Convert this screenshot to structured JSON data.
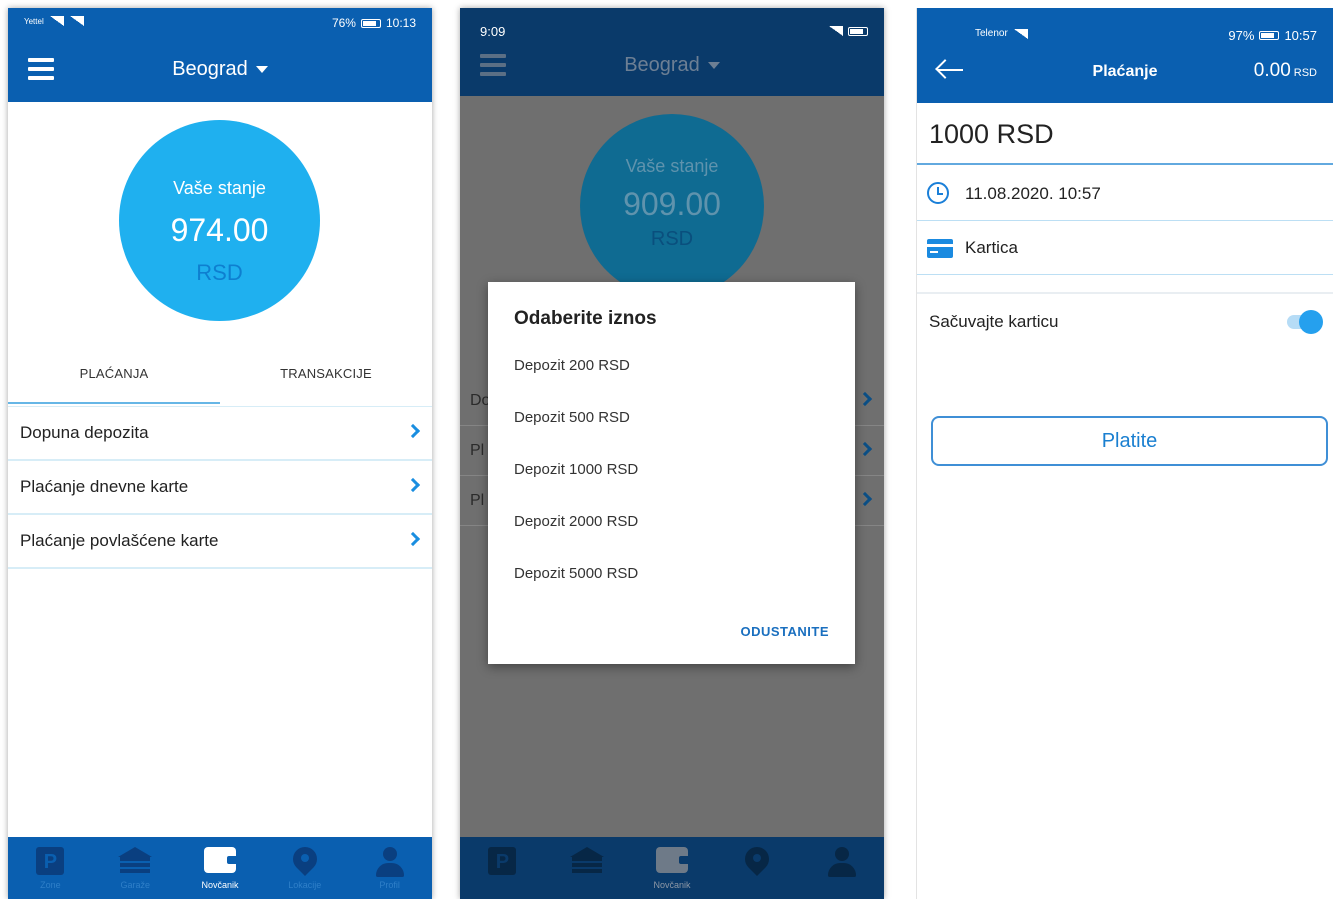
{
  "colors": {
    "primary": "#0a5fb0",
    "accent": "#1fb0ef",
    "link": "#1a8ee0"
  },
  "screen1": {
    "status": {
      "left": "Yettel",
      "battery": "76%",
      "time": "10:13"
    },
    "city": "Beograd",
    "balance": {
      "label": "Vaše stanje",
      "amount": "974.00",
      "currency": "RSD"
    },
    "tabs": [
      {
        "label": "PLAĆANJA"
      },
      {
        "label": "TRANSAKCIJE"
      }
    ],
    "items": [
      {
        "label": "Dopuna depozita"
      },
      {
        "label": "Plaćanje dnevne karte"
      },
      {
        "label": "Plaćanje povlašćene karte"
      }
    ],
    "nav": [
      {
        "label": "Zone",
        "icon": "parking-icon"
      },
      {
        "label": "Garaže",
        "icon": "garage-icon"
      },
      {
        "label": "Novčanik",
        "icon": "wallet-icon"
      },
      {
        "label": "Lokacije",
        "icon": "location-pin-icon"
      },
      {
        "label": "Profil",
        "icon": "user-icon"
      }
    ]
  },
  "screen2": {
    "status": {
      "time": "9:09"
    },
    "city": "Beograd",
    "balance": {
      "label": "Vaše stanje",
      "amount": "909.00",
      "currency": "RSD"
    },
    "ghost_rows": [
      {
        "label": "Do"
      },
      {
        "label": "Pl"
      },
      {
        "label": "Pl"
      }
    ],
    "dialog": {
      "title": "Odaberite iznos",
      "options": [
        "Depozit 200 RSD",
        "Depozit 500 RSD",
        "Depozit 1000 RSD",
        "Depozit 2000 RSD",
        "Depozit 5000 RSD"
      ],
      "cancel": "ODUSTANITE"
    },
    "nav_active_label": "Novčanik"
  },
  "screen3": {
    "status": {
      "carrier": "Telenor",
      "battery": "97%",
      "time": "10:57"
    },
    "title": "Plaćanje",
    "balance": {
      "amount": "0.00",
      "currency": "RSD"
    },
    "amount": "1000 RSD",
    "datetime": "11.08.2020. 10:57",
    "payment_method": "Kartica",
    "save_card_label": "Sačuvajte karticu",
    "save_card_enabled": true,
    "pay_button": "Platite"
  }
}
